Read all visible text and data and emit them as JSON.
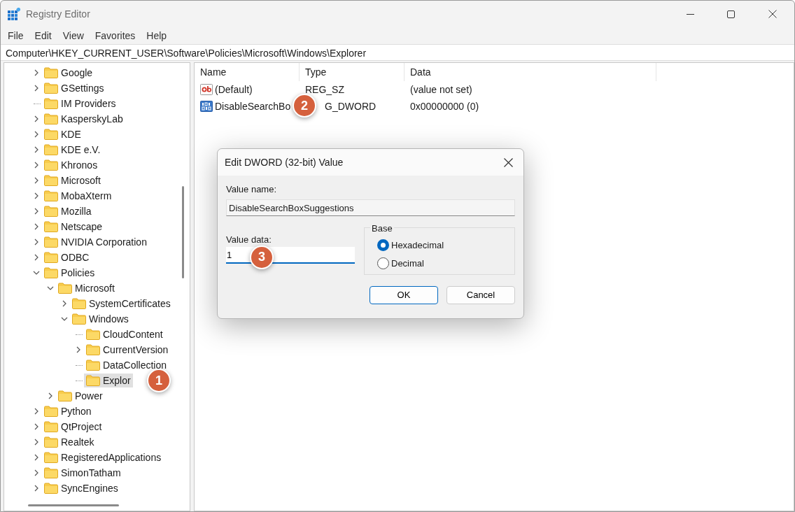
{
  "window": {
    "title": "Registry Editor"
  },
  "menu": [
    "File",
    "Edit",
    "View",
    "Favorites",
    "Help"
  ],
  "address": "Computer\\HKEY_CURRENT_USER\\Software\\Policies\\Microsoft\\Windows\\Explorer",
  "tree": {
    "items": [
      {
        "label": "Google",
        "expandable": true,
        "expanded": false,
        "selected": false
      },
      {
        "label": "GSettings",
        "expandable": true,
        "expanded": false,
        "selected": false
      },
      {
        "label": "IM Providers",
        "expandable": false,
        "selected": false
      },
      {
        "label": "KasperskyLab",
        "expandable": true,
        "expanded": false,
        "selected": false
      },
      {
        "label": "KDE",
        "expandable": true,
        "expanded": false,
        "selected": false
      },
      {
        "label": "KDE e.V.",
        "expandable": true,
        "expanded": false,
        "selected": false
      },
      {
        "label": "Khronos",
        "expandable": true,
        "expanded": false,
        "selected": false
      },
      {
        "label": "Microsoft",
        "expandable": true,
        "expanded": false,
        "selected": false
      },
      {
        "label": "MobaXterm",
        "expandable": true,
        "expanded": false,
        "selected": false
      },
      {
        "label": "Mozilla",
        "expandable": true,
        "expanded": false,
        "selected": false
      },
      {
        "label": "Netscape",
        "expandable": true,
        "expanded": false,
        "selected": false
      },
      {
        "label": "NVIDIA Corporation",
        "expandable": true,
        "expanded": false,
        "selected": false
      },
      {
        "label": "ODBC",
        "expandable": true,
        "expanded": false,
        "selected": false
      },
      {
        "label": "Policies",
        "expandable": true,
        "expanded": true,
        "selected": false,
        "children": [
          {
            "label": "Microsoft",
            "expandable": true,
            "expanded": true,
            "selected": false,
            "children": [
              {
                "label": "SystemCertificates",
                "expandable": true,
                "expanded": false,
                "selected": false
              },
              {
                "label": "Windows",
                "expandable": true,
                "expanded": true,
                "selected": false,
                "children": [
                  {
                    "label": "CloudContent",
                    "expandable": false,
                    "selected": false
                  },
                  {
                    "label": "CurrentVersion",
                    "expandable": true,
                    "expanded": false,
                    "selected": false
                  },
                  {
                    "label": "DataCollection",
                    "expandable": false,
                    "selected": false
                  },
                  {
                    "label": "Explor",
                    "expandable": false,
                    "selected": true,
                    "callout": "1"
                  }
                ]
              }
            ]
          },
          {
            "label": "Power",
            "expandable": true,
            "expanded": false,
            "selected": false
          }
        ]
      },
      {
        "label": "Python",
        "expandable": true,
        "expanded": false,
        "selected": false
      },
      {
        "label": "QtProject",
        "expandable": true,
        "expanded": false,
        "selected": false
      },
      {
        "label": "Realtek",
        "expandable": true,
        "expanded": false,
        "selected": false
      },
      {
        "label": "RegisteredApplications",
        "expandable": true,
        "expanded": false,
        "selected": false
      },
      {
        "label": "SimonTatham",
        "expandable": true,
        "expanded": false,
        "selected": false
      },
      {
        "label": "SyncEngines",
        "expandable": true,
        "expanded": false,
        "selected": false
      }
    ]
  },
  "values": {
    "columns": [
      "Name",
      "Type",
      "Data"
    ],
    "rows": [
      {
        "kind": "string",
        "name": "(Default)",
        "type": "REG_SZ",
        "data": "(value not set)"
      },
      {
        "kind": "binary",
        "name": "DisableSearchBo",
        "type": "G_DWORD",
        "data": "0x00000000 (0)",
        "callout": "2"
      }
    ]
  },
  "dialog": {
    "title": "Edit DWORD (32-bit) Value",
    "value_name_label": "Value name:",
    "value_name": "DisableSearchBoxSuggestions",
    "value_data_label": "Value data:",
    "value_data": "1",
    "value_data_callout": "3",
    "base_label": "Base",
    "base_options": [
      {
        "label": "Hexadecimal",
        "selected": true
      },
      {
        "label": "Decimal",
        "selected": false
      }
    ],
    "buttons": [
      {
        "label": "OK",
        "default": true
      },
      {
        "label": "Cancel",
        "default": false
      }
    ]
  }
}
